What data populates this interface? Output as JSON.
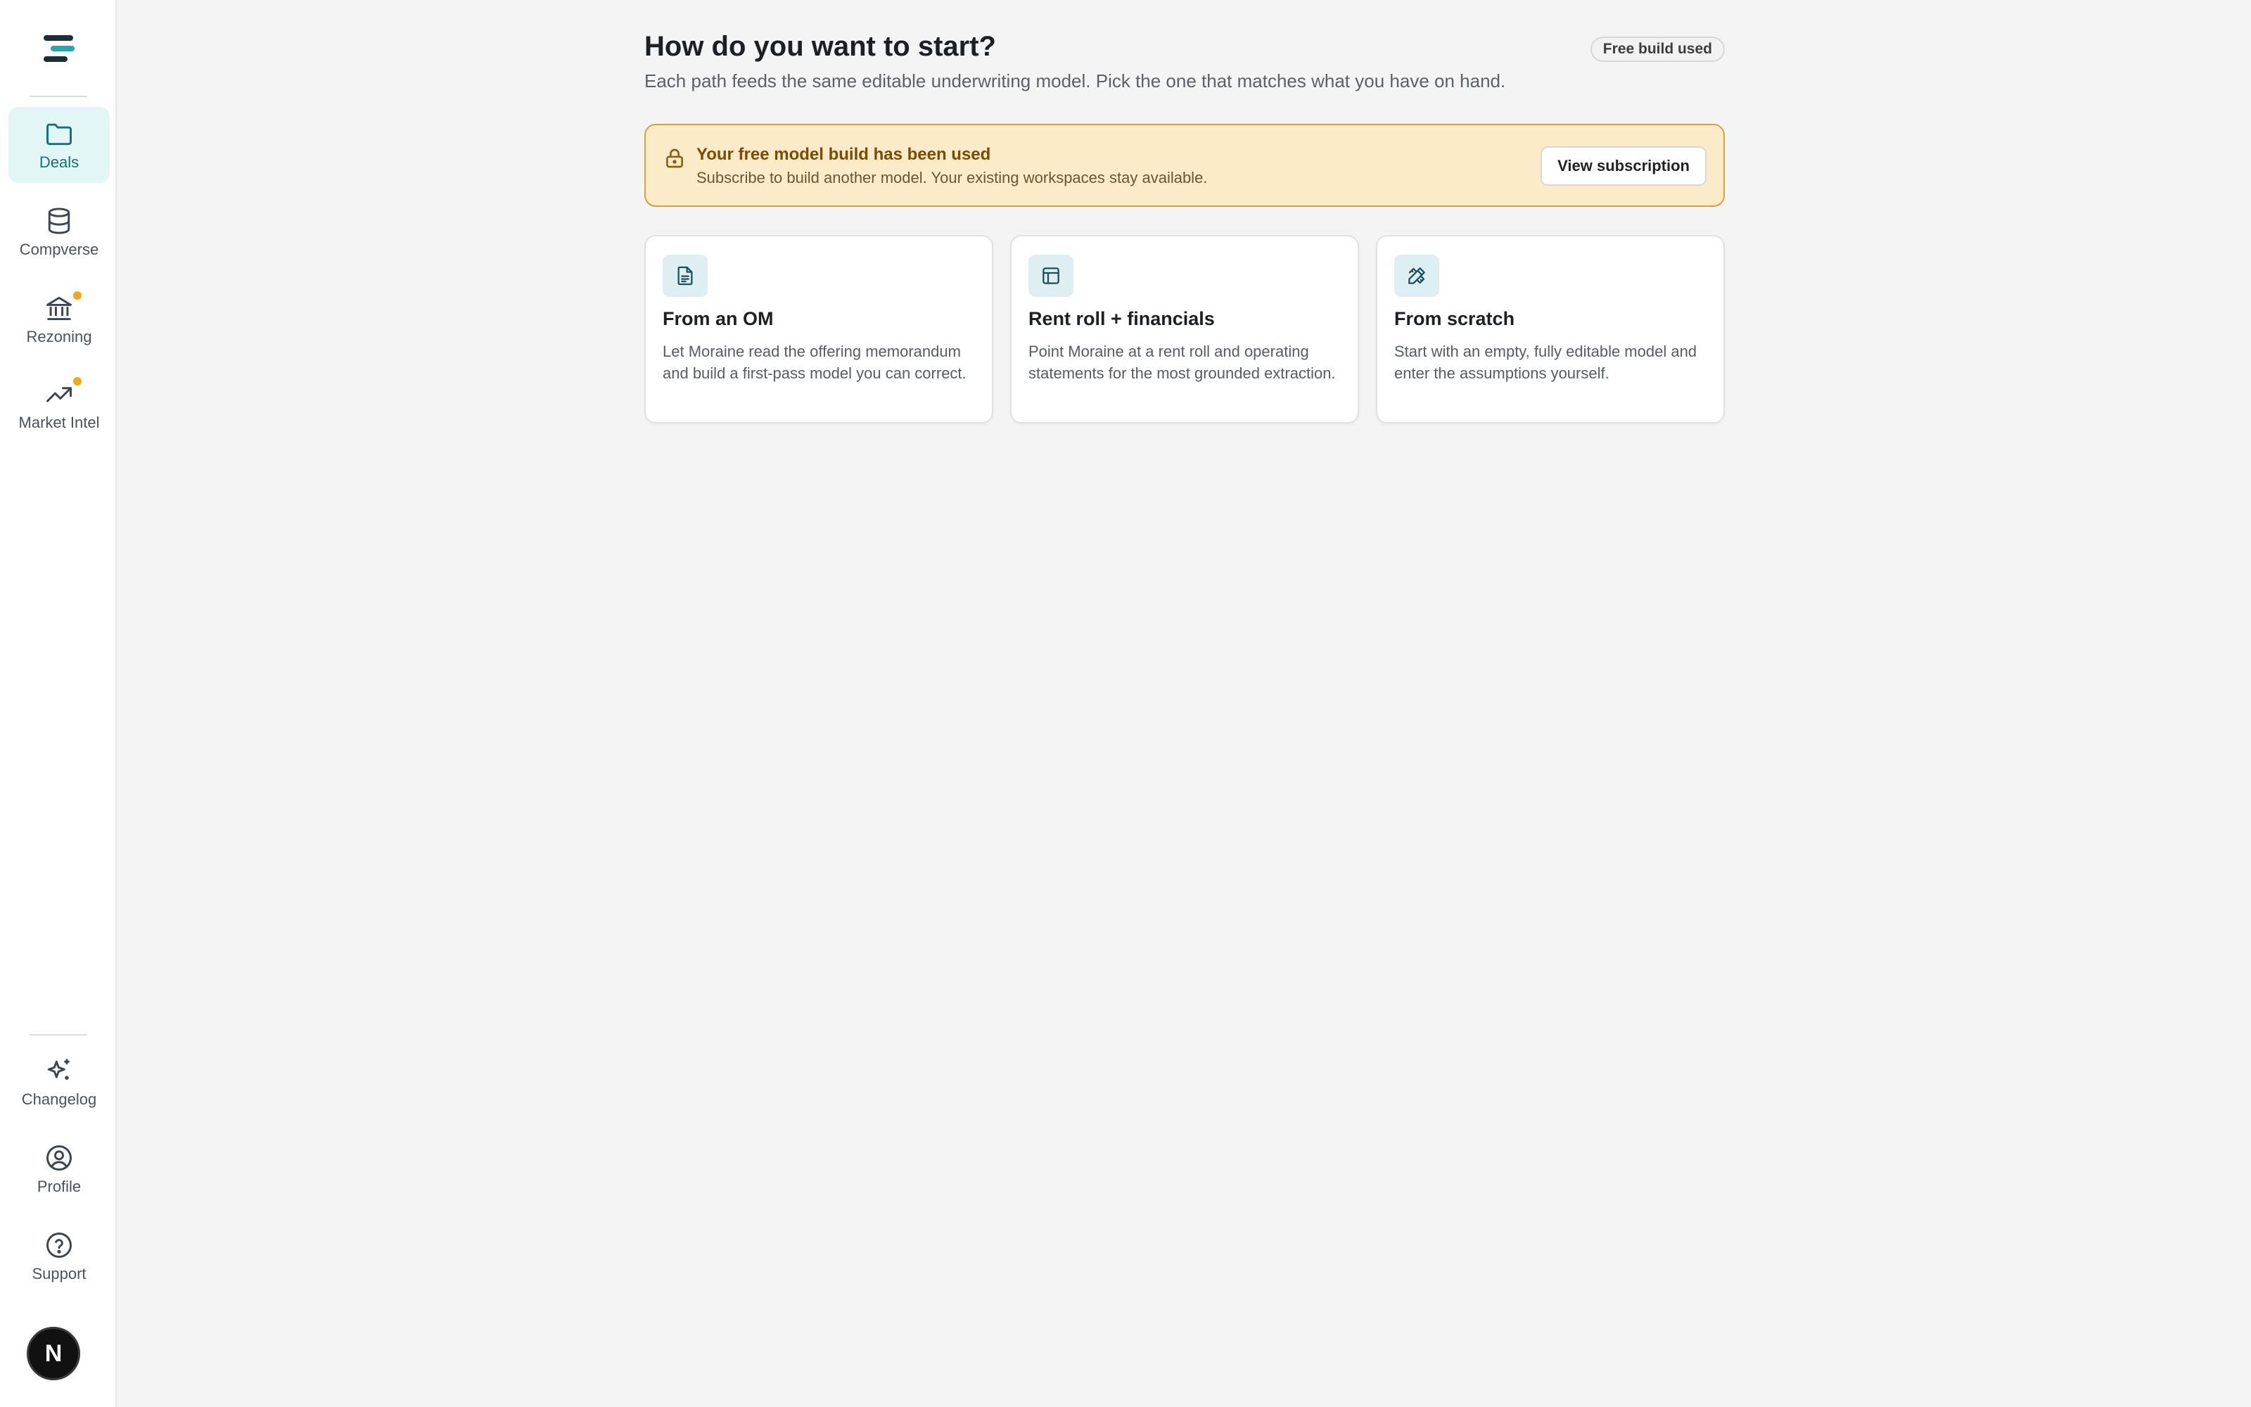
{
  "sidebar": {
    "nav": [
      {
        "label": "Deals",
        "icon": "folder-icon",
        "active": true
      },
      {
        "label": "Compverse",
        "icon": "database-icon",
        "active": false
      },
      {
        "label": "Rezoning",
        "icon": "bank-icon",
        "active": false,
        "dot": true
      },
      {
        "label": "Market Intel",
        "icon": "trending-up-icon",
        "active": false,
        "dot": true
      }
    ],
    "bottom": [
      {
        "label": "Changelog",
        "icon": "sparkles-icon"
      },
      {
        "label": "Profile",
        "icon": "user-circle-icon"
      },
      {
        "label": "Support",
        "icon": "help-circle-icon"
      }
    ],
    "avatar_letter": "N"
  },
  "header": {
    "title": "How do you want to start?",
    "subtitle": "Each path feeds the same editable underwriting model. Pick the one that matches what you have on hand.",
    "badge": "Free build used"
  },
  "alert": {
    "title": "Your free model build has been used",
    "text": "Subscribe to build another model. Your existing workspaces stay available.",
    "button": "View subscription"
  },
  "options": [
    {
      "title": "From an OM",
      "desc": "Let Moraine read the offering memorandum and build a first-pass model you can correct.",
      "icon": "document-icon"
    },
    {
      "title": "Rent roll + financials",
      "desc": "Point Moraine at a rent roll and operating statements for the most grounded extraction.",
      "icon": "table-icon"
    },
    {
      "title": "From scratch",
      "desc": "Start with an empty, fully editable model and enter the assumptions yourself.",
      "icon": "pencil-ruler-icon"
    }
  ],
  "colors": {
    "accent": "#14707a",
    "active_bg": "#e3f6f6",
    "alert_bg": "#fcebc9",
    "alert_border": "#d7a041",
    "notification_dot": "#f3a81c"
  }
}
